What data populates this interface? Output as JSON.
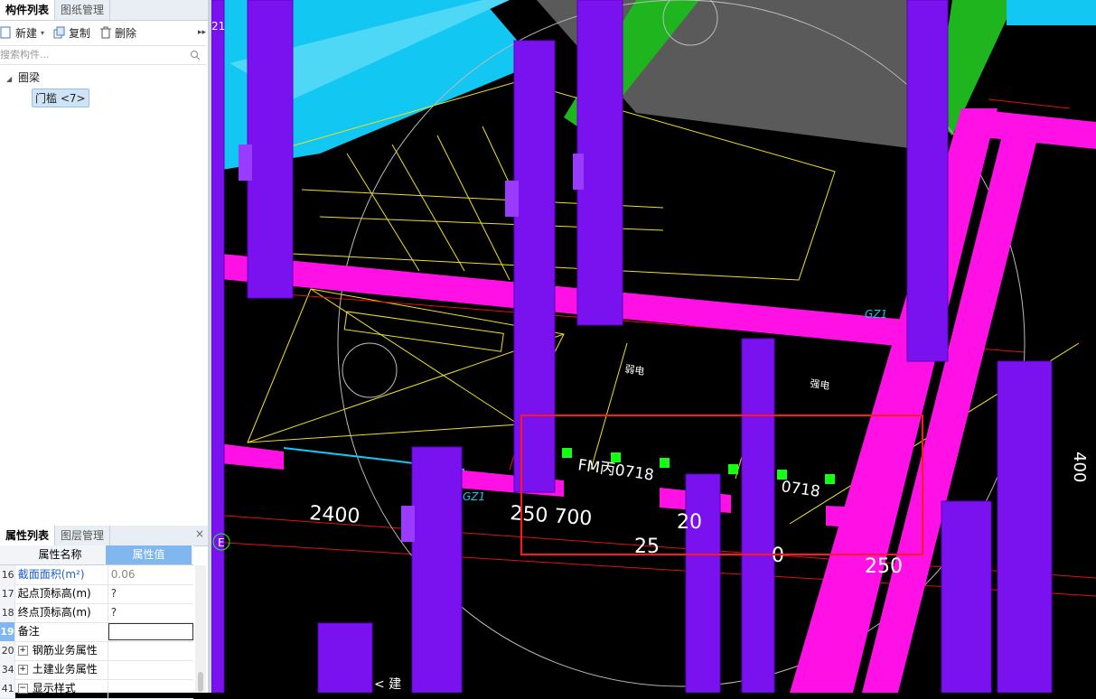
{
  "component_panel": {
    "tabs": [
      "构件列表",
      "图纸管理"
    ],
    "toolbar": {
      "new_label": "新建",
      "copy_label": "复制",
      "delete_label": "删除"
    },
    "search_placeholder": "搜索构件...",
    "tree": {
      "category": "圈梁",
      "item": "门槛 <7>"
    }
  },
  "property_panel": {
    "tabs": [
      "属性列表",
      "图层管理"
    ],
    "header": {
      "name": "属性名称",
      "value": "属性值"
    },
    "rows": [
      {
        "num": "16",
        "name": "截面面积(m²)",
        "value": "0.06"
      },
      {
        "num": "17",
        "name": "起点顶标高(m)",
        "value": "?"
      },
      {
        "num": "18",
        "name": "终点顶标高(m)",
        "value": "?"
      },
      {
        "num": "19",
        "name": "备注",
        "value": ""
      },
      {
        "num": "20",
        "name": "钢筋业务属性",
        "value": ""
      },
      {
        "num": "34",
        "name": "土建业务属性",
        "value": ""
      },
      {
        "num": "41",
        "name": "显示样式",
        "value": ""
      }
    ]
  },
  "viewport": {
    "labels": {
      "weak_power": "弱电",
      "strong_power": "强电",
      "door_a": "FM丙0718",
      "door_b": "0718",
      "gz_top": "GZ1",
      "gz_left": "GZ1",
      "axis_e": "E",
      "dim_2400": "2400",
      "dim_250_700": "250 700",
      "dim_20": "20",
      "dim_25": "25",
      "dim_0": "0",
      "dim_250": "250",
      "dim_right": "400",
      "top_num": "21",
      "bottom_text": "< 建"
    },
    "colors": {
      "column": "#7a12f0",
      "beam": "#ff11e6",
      "stair": "#12c7f2",
      "wall": "#1fb51f",
      "selection": "#ff1a1a"
    }
  }
}
